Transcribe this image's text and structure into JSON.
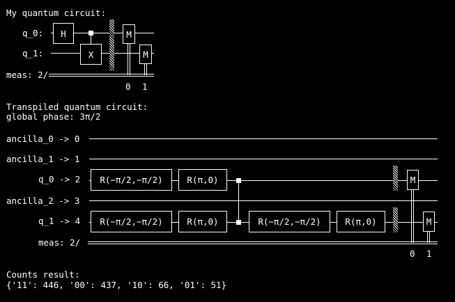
{
  "terminal": {
    "circuit1_title": "My quantum circuit:",
    "circuit1": {
      "wire_labels": [
        "q_0:",
        "q_1:",
        "meas: 2/"
      ],
      "gates": {
        "h": "H",
        "x": "X",
        "measure": "M"
      },
      "meas_indices": [
        "0",
        "1"
      ]
    },
    "circuit2_title": "Transpiled quantum circuit:",
    "global_phase": "global phase: 3π/2",
    "circuit2": {
      "wire_labels": [
        "ancilla_0 -> 0",
        "ancilla_1 -> 1",
        "q_0 -> 2",
        "ancilla_2 -> 3",
        "q_1 -> 4",
        "meas: 2/"
      ],
      "gates": {
        "r1": "R(−π/2,−π/2)",
        "r2": "R(π,0)",
        "measure": "M"
      },
      "meas_indices": [
        "0",
        "1"
      ]
    },
    "counts_title": "Counts result:",
    "counts_value": "{'11': 446, '00': 437, '10': 66, '01': 51}"
  }
}
